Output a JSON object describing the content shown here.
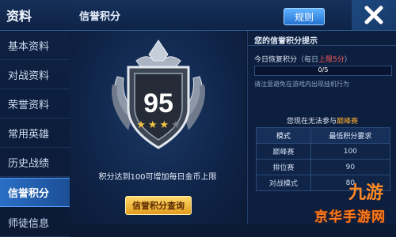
{
  "sidebar": {
    "title": "资料",
    "items": [
      {
        "label": "基本资料"
      },
      {
        "label": "对战资料"
      },
      {
        "label": "荣誉资料"
      },
      {
        "label": "常用英雄"
      },
      {
        "label": "历史战绩"
      },
      {
        "label": "信誉积分",
        "active": true
      },
      {
        "label": "师徒信息"
      }
    ]
  },
  "header": {
    "title": "信誉积分",
    "rules_label": "规则",
    "close_icon": "close-icon"
  },
  "center": {
    "score": "95",
    "stars_filled": 3,
    "stars_total": 4,
    "info_text": "积分达到100可增加每日金币上限",
    "query_button": "信誉积分查询"
  },
  "right": {
    "tip_title": "您的信誉积分提示",
    "recover_label": "今日恢复积分",
    "recover_paren_open": "（每日",
    "recover_limit": "上限5分",
    "recover_paren_close": "）",
    "progress_text": "0/5",
    "progress_value": 0,
    "hint": "请注意避免在游戏内出现挂机行为",
    "cannot_prefix": "您现在无法参与",
    "cannot_mode": "巅峰赛",
    "table": {
      "headers": [
        "模式",
        "最低积分要求"
      ],
      "rows": [
        [
          "巅峰赛",
          "100"
        ],
        [
          "排位赛",
          "90"
        ],
        [
          "对战模式",
          "80"
        ]
      ]
    }
  },
  "watermark": {
    "logo_text": "九游",
    "site_text": "京华手游网"
  },
  "colors": {
    "active_nav": "#2a6fc6",
    "star_gold": "#f5c542",
    "star_empty": "#7a7f88",
    "query_button": "#f0b33a",
    "highlight_red": "#ff5a5a",
    "highlight_orange": "#ffae2e"
  }
}
